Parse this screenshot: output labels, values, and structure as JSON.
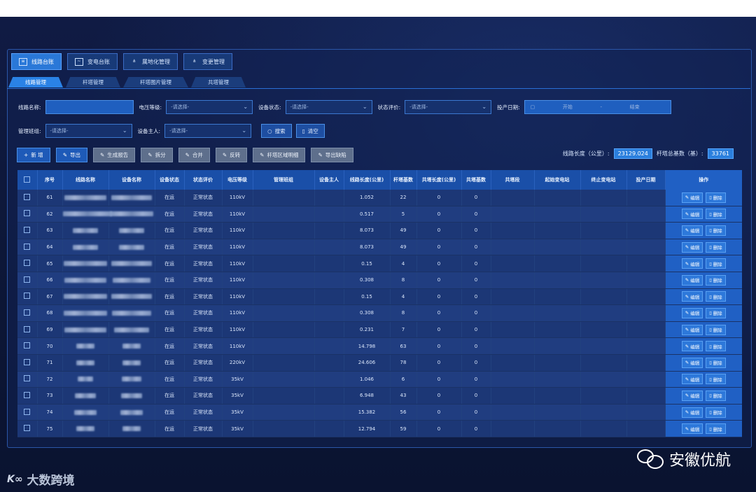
{
  "main_tabs": [
    {
      "label": "线路台账",
      "icon": "list-icon",
      "active": true
    },
    {
      "label": "变电台账",
      "icon": "monitor-icon",
      "active": false
    },
    {
      "label": "属地化管理",
      "icon": "tree-icon",
      "active": false
    },
    {
      "label": "变更管理",
      "icon": "tree-icon",
      "active": false
    }
  ],
  "sub_tabs": [
    {
      "label": "线路管理",
      "active": true
    },
    {
      "label": "杆塔管理",
      "active": false
    },
    {
      "label": "杆塔图片管理",
      "active": false
    },
    {
      "label": "共塔管理",
      "active": false
    }
  ],
  "filters": {
    "line_name_label": "线路名称:",
    "line_name_value": "",
    "voltage_label": "电压等级:",
    "voltage_value": "-请选择-",
    "device_status_label": "设备状态:",
    "device_status_value": "-请选择-",
    "status_eval_label": "状态评价:",
    "status_eval_value": "-请选择-",
    "commission_date_label": "投产日期:",
    "date_start": "开始",
    "date_sep": "-",
    "date_end": "结束",
    "team_label": "管理班组:",
    "team_value": "-请选择-",
    "owner_label": "设备主人:",
    "owner_value": "-请选择-",
    "search_label": "搜索",
    "clear_label": "清空"
  },
  "toolbar": {
    "add_label": "新 增",
    "export_label": "导出",
    "report_label": "生成报告",
    "split_label": "拆分",
    "merge_label": "合并",
    "reverse_label": "反转",
    "tower_detail_label": "杆塔区域明细",
    "export_defect_label": "导出缺陷"
  },
  "stats": {
    "length_label": "线路长度（公里）:",
    "length_value": "23129.024",
    "towers_label": "杆塔总基数（基）:",
    "towers_value": "33761"
  },
  "table": {
    "headers": [
      "序号",
      "线路名称",
      "设备名称",
      "设备状态",
      "状态评价",
      "电压等级",
      "管理班组",
      "设备主人",
      "线路长度(公里)",
      "杆塔基数",
      "共塔长度(公里)",
      "共塔基数",
      "共塔段",
      "起始变电站",
      "终止变电站",
      "投产日期",
      "操作"
    ],
    "edit_label": "编辑",
    "delete_label": "删除",
    "rows": [
      {
        "no": "61",
        "status": "在运",
        "eval": "正常状态",
        "voltage": "110kV",
        "length": "1.052",
        "towers": "22",
        "shared_len": "0",
        "shared_cnt": "0"
      },
      {
        "no": "62",
        "status": "在运",
        "eval": "正常状态",
        "voltage": "110kV",
        "length": "0.517",
        "towers": "5",
        "shared_len": "0",
        "shared_cnt": "0"
      },
      {
        "no": "63",
        "status": "在运",
        "eval": "正常状态",
        "voltage": "110kV",
        "length": "8.073",
        "towers": "49",
        "shared_len": "0",
        "shared_cnt": "0"
      },
      {
        "no": "64",
        "status": "在运",
        "eval": "正常状态",
        "voltage": "110kV",
        "length": "8.073",
        "towers": "49",
        "shared_len": "0",
        "shared_cnt": "0"
      },
      {
        "no": "65",
        "status": "在运",
        "eval": "正常状态",
        "voltage": "110kV",
        "length": "0.15",
        "towers": "4",
        "shared_len": "0",
        "shared_cnt": "0"
      },
      {
        "no": "66",
        "status": "在运",
        "eval": "正常状态",
        "voltage": "110kV",
        "length": "0.308",
        "towers": "8",
        "shared_len": "0",
        "shared_cnt": "0"
      },
      {
        "no": "67",
        "status": "在运",
        "eval": "正常状态",
        "voltage": "110kV",
        "length": "0.15",
        "towers": "4",
        "shared_len": "0",
        "shared_cnt": "0"
      },
      {
        "no": "68",
        "status": "在运",
        "eval": "正常状态",
        "voltage": "110kV",
        "length": "0.308",
        "towers": "8",
        "shared_len": "0",
        "shared_cnt": "0"
      },
      {
        "no": "69",
        "status": "在运",
        "eval": "正常状态",
        "voltage": "110kV",
        "length": "0.231",
        "towers": "7",
        "shared_len": "0",
        "shared_cnt": "0"
      },
      {
        "no": "70",
        "status": "在运",
        "eval": "正常状态",
        "voltage": "110kV",
        "length": "14.798",
        "towers": "63",
        "shared_len": "0",
        "shared_cnt": "0"
      },
      {
        "no": "71",
        "status": "在运",
        "eval": "正常状态",
        "voltage": "220kV",
        "length": "24.606",
        "towers": "78",
        "shared_len": "0",
        "shared_cnt": "0"
      },
      {
        "no": "72",
        "status": "在运",
        "eval": "正常状态",
        "voltage": "35kV",
        "length": "1.046",
        "towers": "6",
        "shared_len": "0",
        "shared_cnt": "0"
      },
      {
        "no": "73",
        "status": "在运",
        "eval": "正常状态",
        "voltage": "35kV",
        "length": "6.948",
        "towers": "43",
        "shared_len": "0",
        "shared_cnt": "0"
      },
      {
        "no": "74",
        "status": "在运",
        "eval": "正常状态",
        "voltage": "35kV",
        "length": "15.382",
        "towers": "56",
        "shared_len": "0",
        "shared_cnt": "0"
      },
      {
        "no": "75",
        "status": "在运",
        "eval": "正常状态",
        "voltage": "35kV",
        "length": "12.794",
        "towers": "59",
        "shared_len": "0",
        "shared_cnt": "0"
      }
    ]
  },
  "watermarks": {
    "left_logo": "K∞",
    "left_text": "大数跨境",
    "right_text": "安徽优航"
  }
}
